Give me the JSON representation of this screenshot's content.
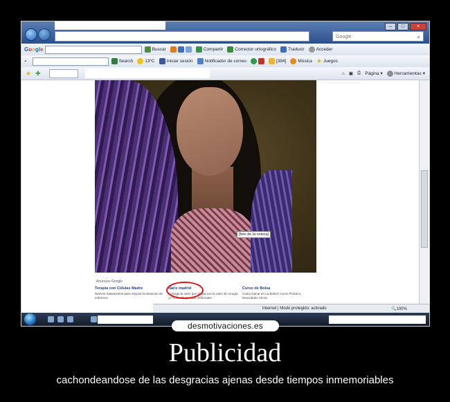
{
  "browser": {
    "search_placeholder": "Google",
    "google_toolbar": {
      "logo": "Google",
      "buscar": "Buscar",
      "compartir": "Compartir",
      "corrector": "Corrector ortográfico",
      "traducir": "Traducir",
      "acceder": "Acceder"
    },
    "second_toolbar": {
      "search": "Search",
      "weather": "13ºC",
      "login": "Iniciar sesión",
      "notifier": "Notificador de correo",
      "counter": "[384]",
      "musica": "Música",
      "juegos": "Juegos"
    },
    "command_bar": {
      "pagina": "Página",
      "herramientas": "Herramientas"
    },
    "status": {
      "zone": "Internet | Modo protegido: activado",
      "zoom": "100%"
    }
  },
  "content": {
    "photo_caption": "[foto de la noticia]",
    "ads_label": "Anuncios Google",
    "ads": [
      {
        "title": "Terapia con Células Madre",
        "desc": "Nuevos tratamientos para mejorar la situación de enfermos"
      },
      {
        "title": "Nariz madrid",
        "desc": "Consiga la nariz que desea con la nariz sin cirugía ¡1ª consulta gratuita ¡Infórmate!"
      },
      {
        "title": "Curso de Bolsa",
        "desc": "Como Ganar en La Bolsa? Curso Práctico, Descubrelo Ahora"
      }
    ]
  },
  "poster": {
    "brand": "desmotivaciones.es",
    "title": "Publicidad",
    "subtitle": "cachondeandose de las desgracias ajenas desde tiempos inmemoriables"
  },
  "colors": {
    "background": "#000000",
    "highlight_circle": "#e0141b",
    "ad_title": "#1f3f8f"
  }
}
